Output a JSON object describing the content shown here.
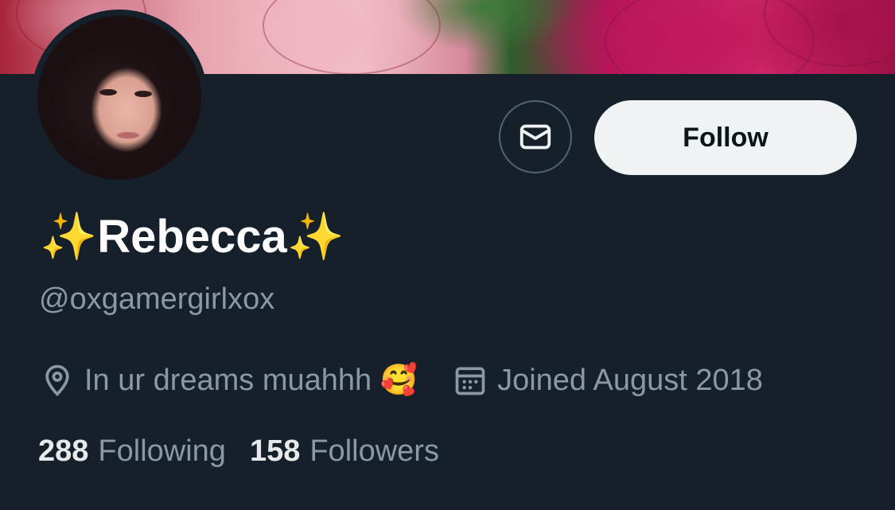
{
  "profile": {
    "display_name": "✨Rebecca✨",
    "handle": "@oxgamergirlxox",
    "location": "In ur dreams muahhh 🥰",
    "joined": "Joined August 2018"
  },
  "actions": {
    "follow_label": "Follow",
    "message_icon": "envelope-icon"
  },
  "stats": {
    "following_count": "288",
    "following_label": "Following",
    "followers_count": "158",
    "followers_label": "Followers"
  },
  "colors": {
    "background": "#15202b",
    "secondary_text": "#8b98a5",
    "primary_text": "#e7e9ea",
    "follow_button_bg": "#eff3f4"
  },
  "icons": {
    "location": "location-pin-icon",
    "calendar": "calendar-icon"
  }
}
